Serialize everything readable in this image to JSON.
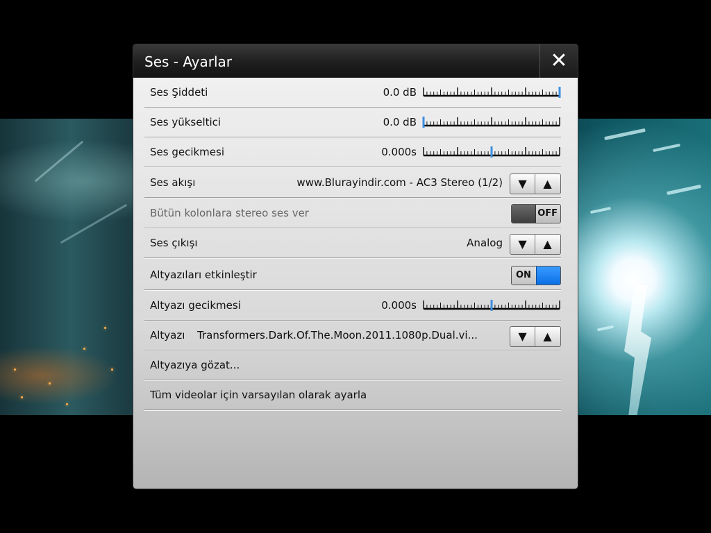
{
  "dialog": {
    "title": "Ses - Ayarlar",
    "close_glyph": "✕"
  },
  "rows": {
    "volume": {
      "label": "Ses Şiddeti",
      "value": "0.0 dB",
      "level": 1.0
    },
    "boost": {
      "label": "Ses yükseltici",
      "value": "0.0 dB",
      "level": 0.0
    },
    "audio_delay": {
      "label": "Ses gecikmesi",
      "value": "0.000s",
      "level": 0.5
    },
    "audio_stream": {
      "label": "Ses akışı",
      "value": "www.Blurayindir.com - AC3 Stereo (1/2)"
    },
    "stereo_all": {
      "label": "Bütün kolonlara stereo ses ver",
      "toggle": "OFF"
    },
    "audio_output": {
      "label": "Ses çıkışı",
      "value": "Analog"
    },
    "subs_enable": {
      "label": "Altyazıları etkinleştir",
      "toggle": "ON"
    },
    "sub_delay": {
      "label": "Altyazı gecikmesi",
      "value": "0.000s",
      "level": 0.5
    },
    "subtitle": {
      "label": "Altyazı",
      "value": "Transformers.Dark.Of.The.Moon.2011.1080p.Dual.vi..."
    },
    "browse_sub": {
      "label": "Altyazıya gözat..."
    },
    "set_default": {
      "label": "Tüm videolar için varsayılan olarak ayarla"
    }
  },
  "spinner": {
    "down_glyph": "▼",
    "up_glyph": "▲"
  },
  "icons": {
    "close": "close-icon",
    "down": "arrow-down-icon",
    "up": "arrow-up-icon"
  },
  "colors": {
    "accent": "#0a7bff",
    "slider_marker": "#3d8fe0",
    "title_bg": "#1e1e1e"
  }
}
